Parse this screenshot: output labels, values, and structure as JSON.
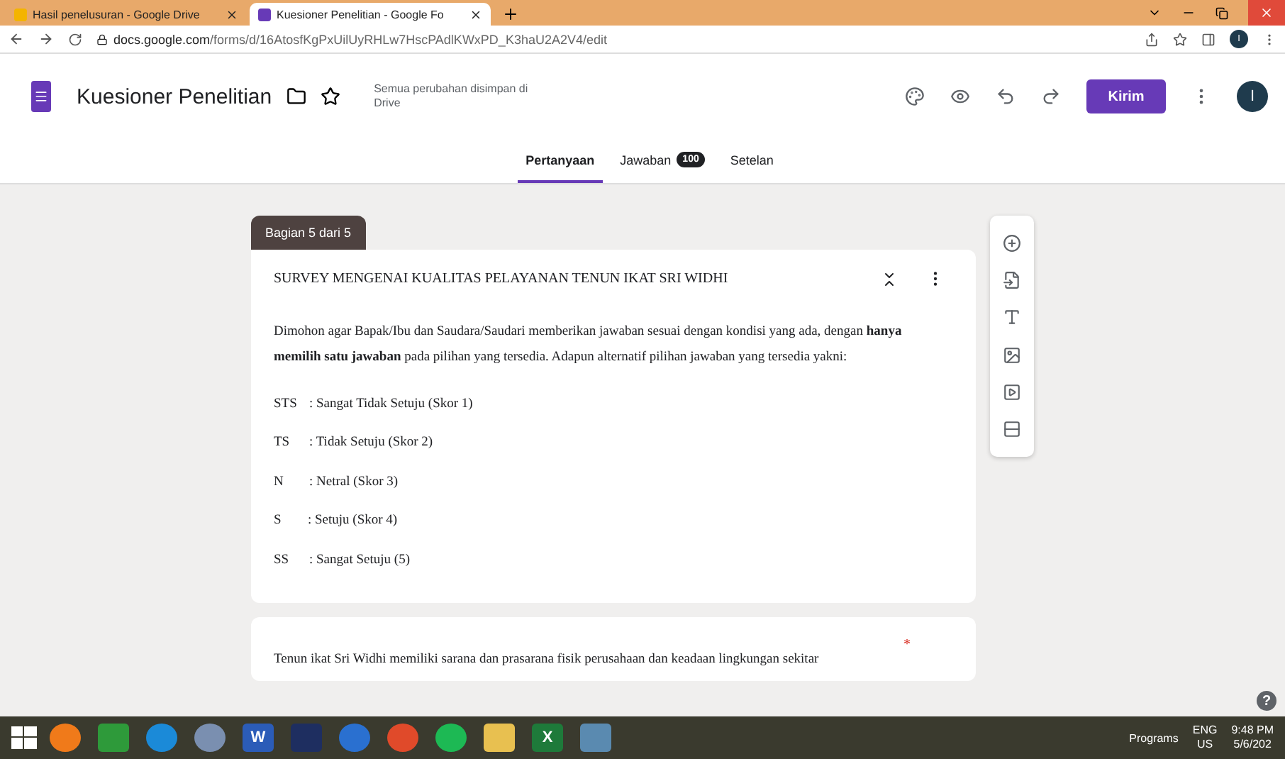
{
  "browser": {
    "tabs": [
      {
        "title": "Hasil penelusuran - Google Drive",
        "selected": false
      },
      {
        "title": "Kuesioner Penelitian - Google Fo",
        "selected": true
      }
    ],
    "url_host": "docs.google.com",
    "url_path": "/forms/d/16AtosfKgPxUilUyRHLw7HscPAdlKWxPD_K3haU2A2V4/edit",
    "profile_initial": "I"
  },
  "header": {
    "title": "Kuesioner Penelitian",
    "save_status": "Semua perubahan disimpan di Drive",
    "send_label": "Kirim",
    "avatar_initial": "I"
  },
  "form_tabs": [
    {
      "label": "Pertanyaan",
      "selected": true
    },
    {
      "label": "Jawaban",
      "badge": "100",
      "selected": false
    },
    {
      "label": "Setelan",
      "selected": false
    }
  ],
  "section": {
    "label": "Bagian 5 dari 5",
    "title": "SURVEY MENGENAI KUALITAS PELAYANAN TENUN IKAT SRI WIDHI",
    "description": "Dimohon agar Bapak/Ibu dan Saudara/Saudari memberikan jawaban sesuai dengan kondisi yang ada, dengan **hanya memilih satu jawaban** pada pilihan yang tersedia. Adapun alternatif pilihan jawaban yang tersedia yakni:",
    "scale": [
      {
        "code": "STS",
        "meaning": ": Sangat Tidak Setuju (Skor 1)"
      },
      {
        "code": "TS",
        "meaning": ": Tidak Setuju (Skor 2)"
      },
      {
        "code": "N",
        "meaning": ": Netral (Skor 3)"
      },
      {
        "code": "S",
        "meaning": ": Setuju (Skor 4)"
      },
      {
        "code": "SS",
        "meaning": ": Sangat Setuju (5)"
      }
    ]
  },
  "question": {
    "required_mark": "*",
    "text": "Tenun ikat Sri Widhi memiliki sarana dan prasarana fisik perusahaan dan keadaan lingkungan sekitar"
  },
  "help_mark": "?",
  "taskbar": {
    "apps": [
      {
        "kind": "circle",
        "color": "#f07a1a"
      },
      {
        "kind": "square",
        "color": "#2e9a3a"
      },
      {
        "kind": "circle",
        "color": "#1b8ad8"
      },
      {
        "kind": "circle",
        "color": "#7a8fb0"
      },
      {
        "kind": "letter",
        "color": "#2b5cb8",
        "letter": "W"
      },
      {
        "kind": "square",
        "color": "#1e2e60"
      },
      {
        "kind": "circle",
        "color": "#2a70d0"
      },
      {
        "kind": "circle",
        "color": "#e04a2a"
      },
      {
        "kind": "circle",
        "color": "#1db954"
      },
      {
        "kind": "square",
        "color": "#e8c050"
      },
      {
        "kind": "letter",
        "color": "#1e7a3a",
        "letter": "X"
      },
      {
        "kind": "square",
        "color": "#5a8ab0"
      }
    ],
    "programs": "Programs",
    "lang": "ENG",
    "region": "US",
    "time": "9:48 PM",
    "date": "5/6/202"
  }
}
